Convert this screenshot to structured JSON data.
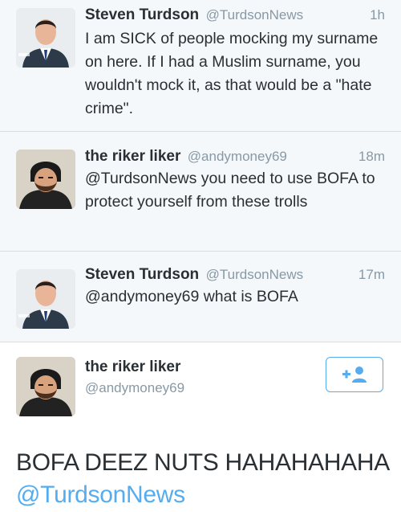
{
  "tweets": [
    {
      "name": "Steven Turdson",
      "handle": "@TurdsonNews",
      "time": "1h",
      "text": "I am SICK of people mocking my surname on here. If I had a Muslim surname, you wouldn't mock it, as that would be a \"hate crime\"."
    },
    {
      "name": "the riker liker",
      "handle": "@andymoney69",
      "time": "18m",
      "text": "@TurdsonNews you need to use BOFA to protect yourself from these trolls"
    },
    {
      "name": "Steven Turdson",
      "handle": "@TurdsonNews",
      "time": "17m",
      "text": "@andymoney69 what is BOFA"
    }
  ],
  "detail": {
    "name": "the riker liker",
    "handle": "@andymoney69",
    "text_main": "BOFA DEEZ NUTS HAHAHAHAHA",
    "mention": "@TurdsonNews",
    "follow_icon": "follow-user-icon"
  },
  "colors": {
    "link": "#55acee",
    "secondary_text": "#8899a6",
    "primary_text": "#292f33"
  }
}
